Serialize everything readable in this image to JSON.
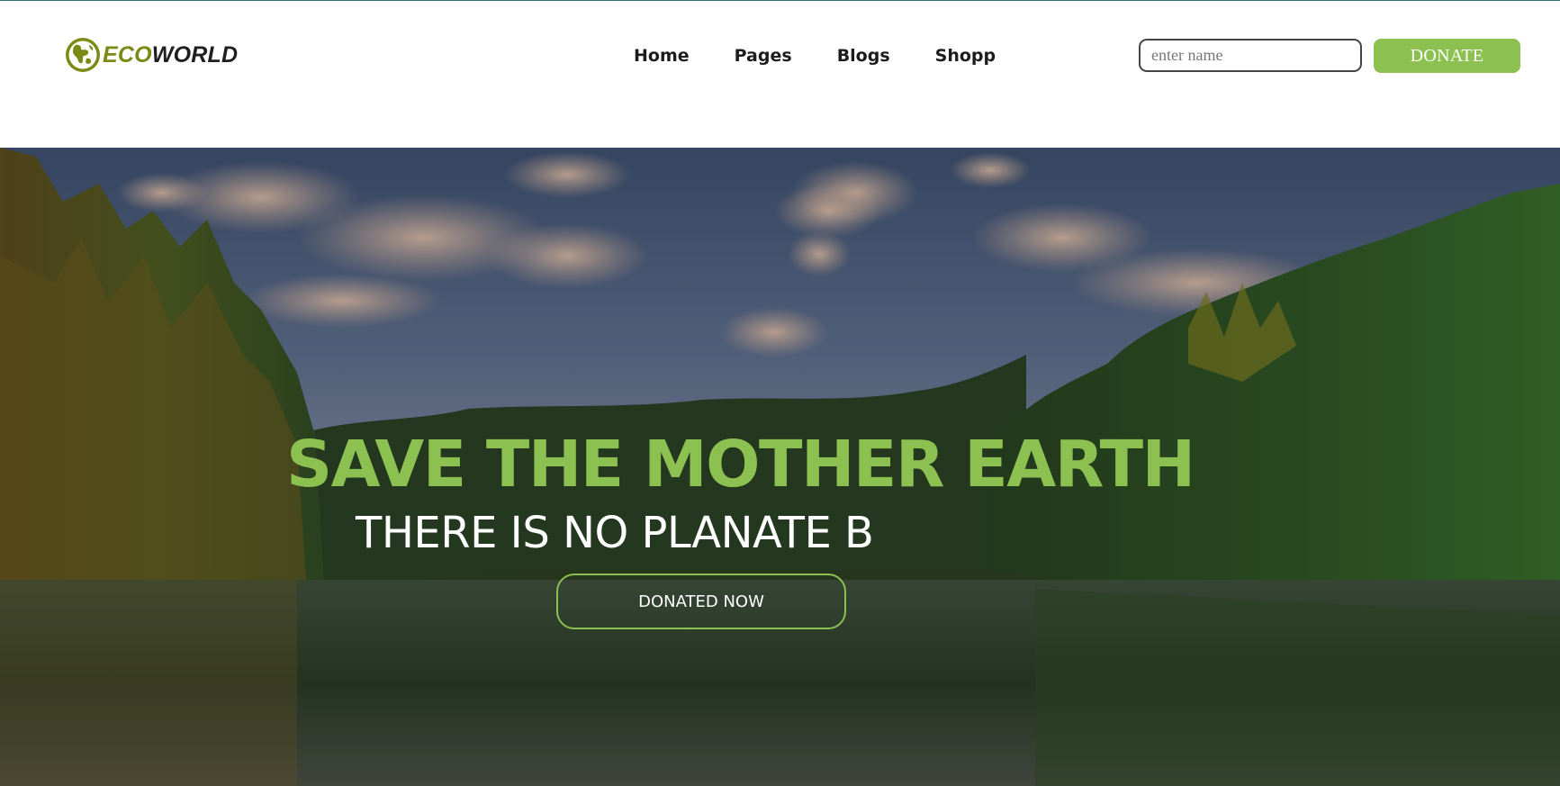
{
  "brand": {
    "name_part1": "ECO",
    "name_part2": "WORLD",
    "logo_icon": "globe-icon",
    "accent_color": "#8cc152",
    "logo_color": "#7a8a12"
  },
  "nav": {
    "items": [
      {
        "label": "Home"
      },
      {
        "label": "Pages"
      },
      {
        "label": "Blogs"
      },
      {
        "label": "Shopp"
      }
    ]
  },
  "header": {
    "name_input": {
      "placeholder": "enter name",
      "value": ""
    },
    "donate_label": "DONATE"
  },
  "hero": {
    "title": "SAVE THE MOTHER EARTH",
    "subtitle": "THERE IS NO PLANATE B",
    "cta_label": "DONATED NOW",
    "background": "forest-lake-photo"
  }
}
